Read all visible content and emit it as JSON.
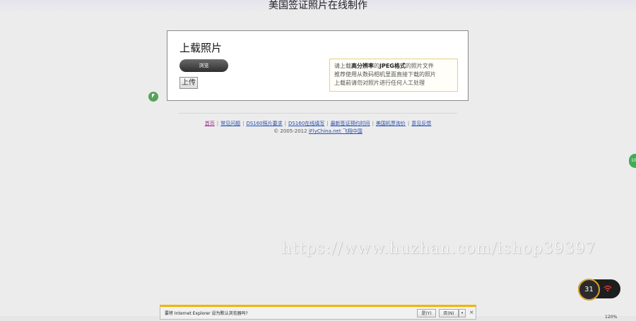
{
  "page": {
    "title": "美国签证照片在线制作"
  },
  "upload": {
    "heading": "上载照片",
    "browse_label": "浏览",
    "upload_label": "上传",
    "hint_lines": {
      "l1_pre": "请上载",
      "l1_bold1": "高分辨率",
      "l1_mid": "的",
      "l1_bold2": "JPEG格式",
      "l1_post": "的照片文件",
      "l2": "推荐使用从数码相机里面直接下载的照片",
      "l3": "上载前请勿对照片进行任何人工处理"
    }
  },
  "footer": {
    "links": [
      "首页",
      "常见问题",
      "DS160照片要求",
      "DS160在线填写",
      "最新签证预约时间",
      "美国机票询价",
      "意见反馈"
    ],
    "copyright_prefix": "© 2005-2012",
    "copyright_link": "iFlyChina.net 飞翔中国"
  },
  "overlay": {
    "watermark": "https://www.huzhan.com/ishop39397",
    "speed_value": "31",
    "side_tab": "10"
  },
  "ie_bar": {
    "message": "要将 Internet Explorer 设为默认浏览器吗?",
    "yes_label": "是(Y)",
    "no_label": "否(N)",
    "dropdown": "▾",
    "close": "×",
    "zoom": "120%"
  },
  "colors": {
    "background": "#ececec",
    "link": "#2a51b0",
    "hint_border": "#e6cf88",
    "notification_accent": "#f0b400"
  },
  "icons": {
    "cursor": "green-circle-pointer",
    "wifi": "wifi-icon",
    "close": "close-icon"
  }
}
